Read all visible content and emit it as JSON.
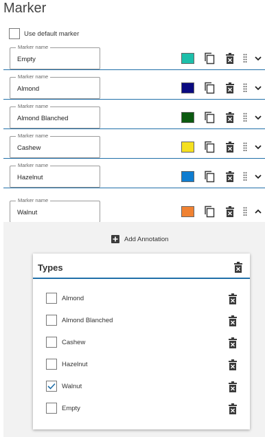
{
  "header": {
    "title": "Marker"
  },
  "default_marker": {
    "label": "Use default marker",
    "checked": false
  },
  "markers": [
    {
      "legend": "Marker name",
      "value": "Empty",
      "color": "#1dbfaa",
      "expanded": false
    },
    {
      "legend": "Marker name",
      "value": "Almond",
      "color": "#0a0a80",
      "expanded": false
    },
    {
      "legend": "Marker name",
      "value": "Almond Blanched",
      "color": "#0b5a10",
      "expanded": false
    },
    {
      "legend": "Marker name",
      "value": "Cashew",
      "color": "#f5e020",
      "expanded": false
    },
    {
      "legend": "Marker name",
      "value": "Hazelnut",
      "color": "#0f7dd0",
      "expanded": false
    },
    {
      "legend": "Marker name",
      "value": "Walnut",
      "color": "#f08232",
      "expanded": true
    }
  ],
  "annotation": {
    "add_label": "Add Annotation"
  },
  "types": {
    "title": "Types",
    "items": [
      {
        "label": "Almond",
        "checked": false
      },
      {
        "label": "Almond Blanched",
        "checked": false
      },
      {
        "label": "Cashew",
        "checked": false
      },
      {
        "label": "Hazelnut",
        "checked": false
      },
      {
        "label": "Walnut",
        "checked": true
      },
      {
        "label": "Empty",
        "checked": false
      }
    ]
  },
  "icons": {
    "copy": "copy-icon",
    "delete": "trash-icon",
    "drag": "drag-handle-icon",
    "collapse": "chevron-up-icon",
    "expand": "chevron-down-icon",
    "add": "plus-icon",
    "check": "check-icon"
  },
  "colors": {
    "accent": "#1e6ea8",
    "icon": "#3b3b3b"
  }
}
